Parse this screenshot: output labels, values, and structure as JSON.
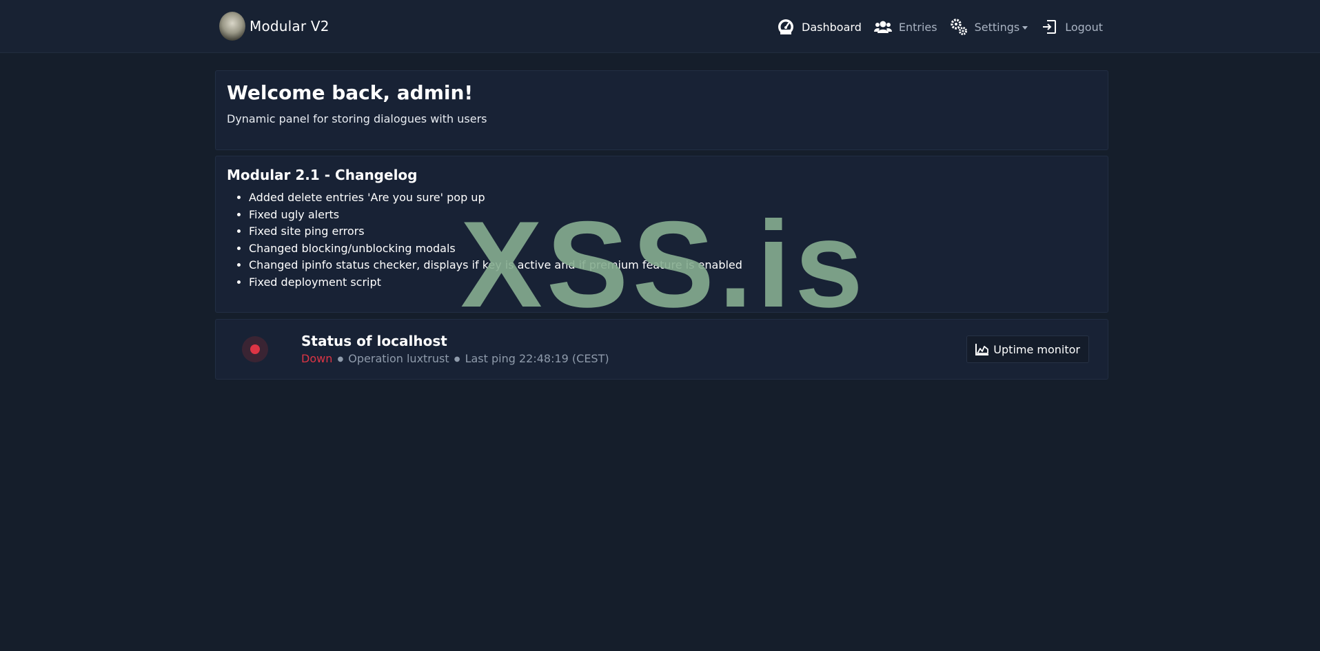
{
  "brand": {
    "name": "Modular V2",
    "logo_icon": "portrait-logo-icon"
  },
  "nav": {
    "items": [
      {
        "label": "Dashboard",
        "icon": "speedometer-icon",
        "active": true
      },
      {
        "label": "Entries",
        "icon": "users-icon",
        "active": false
      },
      {
        "label": "Settings",
        "icon": "gears-icon",
        "active": false,
        "dropdown": true
      },
      {
        "label": "Logout",
        "icon": "logout-icon",
        "active": false
      }
    ]
  },
  "welcome": {
    "title": "Welcome back, admin!",
    "subtitle": "Dynamic panel for storing dialogues with users"
  },
  "changelog": {
    "title": "Modular 2.1 - Changelog",
    "items": [
      "Added delete entries 'Are you sure' pop up",
      "Fixed ugly alerts",
      "Fixed site ping errors",
      "Changed blocking/unblocking modals",
      "Changed ipinfo status checker, displays if key is active and if premium feature is enabled",
      "Fixed deployment script"
    ]
  },
  "status": {
    "title": "Status of localhost",
    "state": "Down",
    "separator": "●",
    "operation": "Operation luxtrust",
    "last_ping": "Last ping 22:48:19 (CEST)",
    "state_color": "#dc3545",
    "button_label": "Uptime monitor",
    "button_icon": "chart-area-icon"
  },
  "watermark": {
    "text": "XSS.is",
    "color": "#86ad90"
  }
}
